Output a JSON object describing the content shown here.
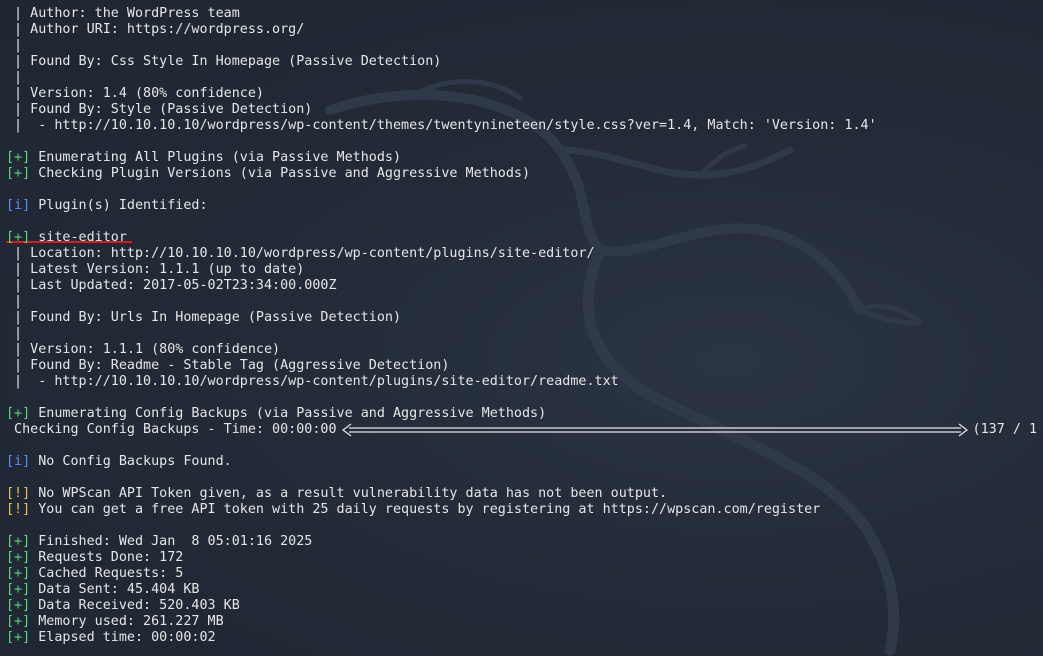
{
  "terminal": {
    "lines": [
      {
        "type": "text",
        "text": " | Author: the WordPress team"
      },
      {
        "type": "text",
        "text": " | Author URI: https://wordpress.org/"
      },
      {
        "type": "text",
        "text": " |"
      },
      {
        "type": "text",
        "text": " | Found By: Css Style In Homepage (Passive Detection)"
      },
      {
        "type": "text",
        "text": " |"
      },
      {
        "type": "text",
        "text": " | Version: 1.4 (80% confidence)"
      },
      {
        "type": "text",
        "text": " | Found By: Style (Passive Detection)"
      },
      {
        "type": "text",
        "text": " |  - http://10.10.10.10/wordpress/wp-content/themes/twentynineteen/style.css?ver=1.4, Match: 'Version: 1.4'"
      },
      {
        "type": "blank",
        "text": ""
      },
      {
        "type": "tagged",
        "tag": "[+]",
        "tag_kind": "plus",
        "text": " Enumerating All Plugins (via Passive Methods)"
      },
      {
        "type": "tagged",
        "tag": "[+]",
        "tag_kind": "plus",
        "text": " Checking Plugin Versions (via Passive and Aggressive Methods)"
      },
      {
        "type": "blank",
        "text": ""
      },
      {
        "type": "tagged",
        "tag": "[i]",
        "tag_kind": "info",
        "text": " Plugin(s) Identified:"
      },
      {
        "type": "blank",
        "text": ""
      },
      {
        "type": "tagged",
        "tag": "[+]",
        "tag_kind": "plus",
        "text": " site-editor"
      },
      {
        "type": "text",
        "text": " | Location: http://10.10.10.10/wordpress/wp-content/plugins/site-editor/"
      },
      {
        "type": "text",
        "text": " | Latest Version: 1.1.1 (up to date)"
      },
      {
        "type": "text",
        "text": " | Last Updated: 2017-05-02T23:34:00.000Z"
      },
      {
        "type": "text",
        "text": " |"
      },
      {
        "type": "text",
        "text": " | Found By: Urls In Homepage (Passive Detection)"
      },
      {
        "type": "text",
        "text": " |"
      },
      {
        "type": "text",
        "text": " | Version: 1.1.1 (80% confidence)"
      },
      {
        "type": "text",
        "text": " | Found By: Readme - Stable Tag (Aggressive Detection)"
      },
      {
        "type": "text",
        "text": " |  - http://10.10.10.10/wordpress/wp-content/plugins/site-editor/readme.txt"
      },
      {
        "type": "blank",
        "text": ""
      },
      {
        "type": "tagged",
        "tag": "[+]",
        "tag_kind": "plus",
        "text": " Enumerating Config Backups (via Passive and Aggressive Methods)"
      },
      {
        "type": "progress",
        "text": " Checking Config Backups - Time: 00:00:00",
        "after": "(137 / 1"
      },
      {
        "type": "blank",
        "text": ""
      },
      {
        "type": "tagged",
        "tag": "[i]",
        "tag_kind": "info",
        "text": " No Config Backups Found."
      },
      {
        "type": "blank",
        "text": ""
      },
      {
        "type": "tagged",
        "tag": "[!]",
        "tag_kind": "warn",
        "text": " No WPScan API Token given, as a result vulnerability data has not been output."
      },
      {
        "type": "tagged",
        "tag": "[!]",
        "tag_kind": "warn",
        "text": " You can get a free API token with 25 daily requests by registering at https://wpscan.com/register"
      },
      {
        "type": "blank",
        "text": ""
      },
      {
        "type": "tagged",
        "tag": "[+]",
        "tag_kind": "plus",
        "text": " Finished: Wed Jan  8 05:01:16 2025"
      },
      {
        "type": "tagged",
        "tag": "[+]",
        "tag_kind": "plus",
        "text": " Requests Done: 172"
      },
      {
        "type": "tagged",
        "tag": "[+]",
        "tag_kind": "plus",
        "text": " Cached Requests: 5"
      },
      {
        "type": "tagged",
        "tag": "[+]",
        "tag_kind": "plus",
        "text": " Data Sent: 45.404 KB"
      },
      {
        "type": "tagged",
        "tag": "[+]",
        "tag_kind": "plus",
        "text": " Data Received: 520.403 KB"
      },
      {
        "type": "tagged",
        "tag": "[+]",
        "tag_kind": "plus",
        "text": " Memory used: 261.227 MB"
      },
      {
        "type": "tagged",
        "tag": "[+]",
        "tag_kind": "plus",
        "text": " Elapsed time: 00:00:02"
      }
    ]
  },
  "colors": {
    "background": "#222a37",
    "text": "#e6e6e6",
    "plus_tag": "#5fd37a",
    "info_tag": "#5b8ef2",
    "warn_tag": "#e9c04a",
    "highlight_underline": "#e01a1a"
  },
  "icons": {
    "watermark": "kali-dragon-watermark"
  }
}
